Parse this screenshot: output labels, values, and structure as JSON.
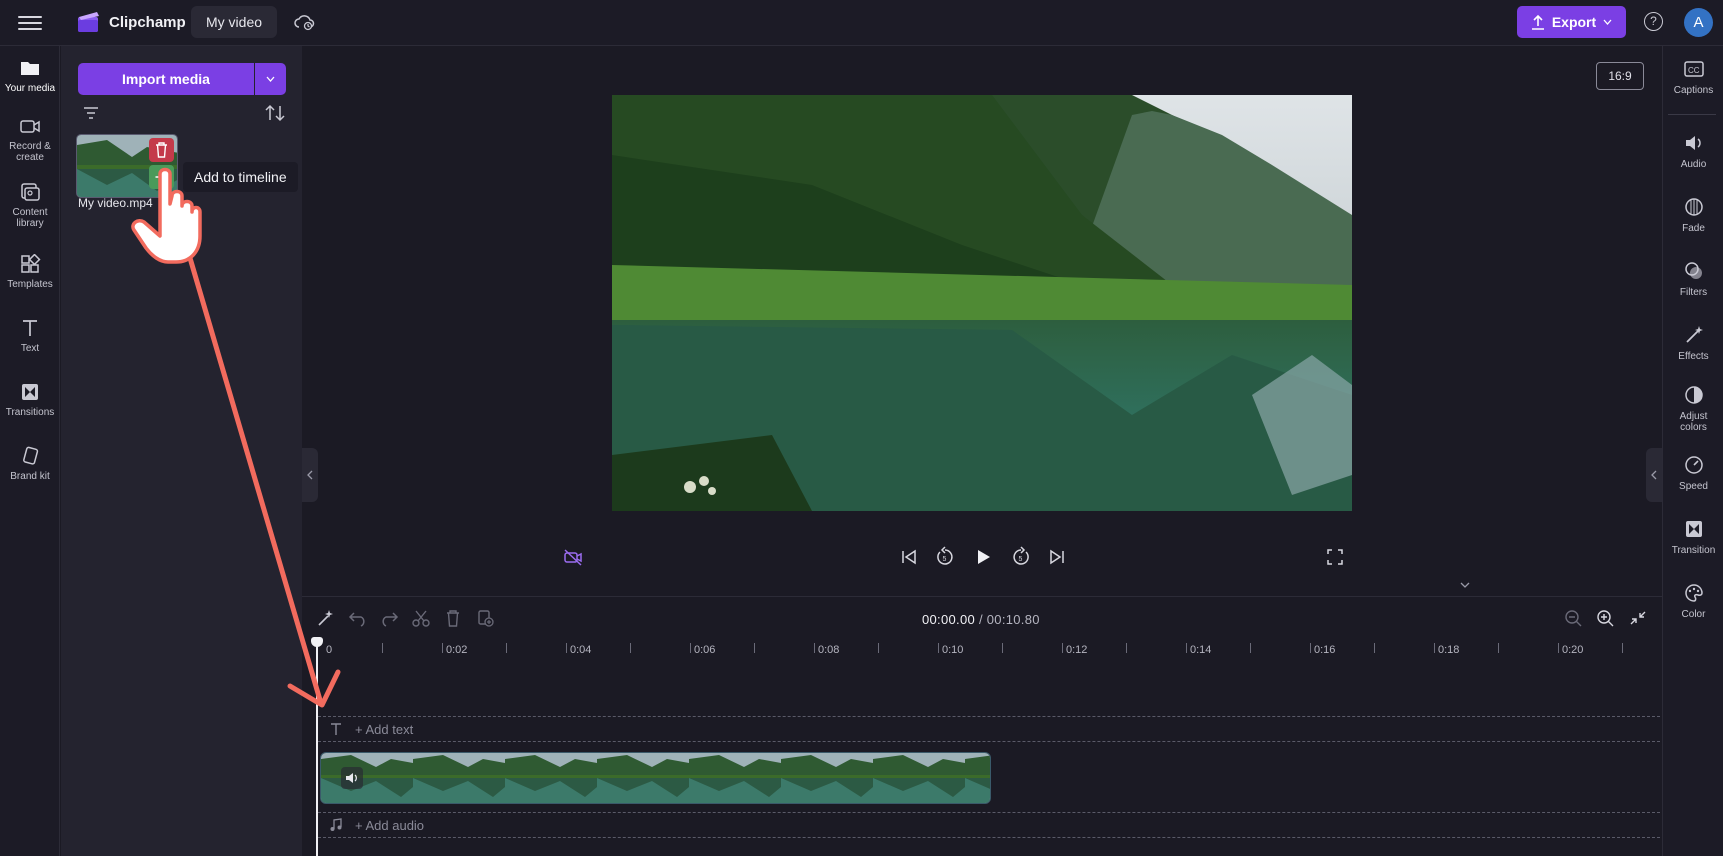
{
  "app": {
    "brand": "Clipchamp",
    "project_title": "My video",
    "export_label": "Export",
    "help_glyph": "?",
    "avatar_initial": "A",
    "accent_color": "#7b3fe4"
  },
  "left_rail": {
    "items": [
      {
        "label": "Your media",
        "icon": "folder-icon"
      },
      {
        "label": "Record & create",
        "icon": "camera-icon"
      },
      {
        "label": "Content library",
        "icon": "library-icon"
      },
      {
        "label": "Templates",
        "icon": "templates-icon"
      },
      {
        "label": "Text",
        "icon": "text-icon"
      },
      {
        "label": "Transitions",
        "icon": "transitions-icon"
      },
      {
        "label": "Brand kit",
        "icon": "brand-kit-icon"
      }
    ]
  },
  "media_panel": {
    "import_label": "Import media",
    "file_name": "My video.mp4",
    "tooltip": "Add to timeline"
  },
  "preview": {
    "aspect_ratio": "16:9"
  },
  "right_rail": {
    "items": [
      {
        "label": "Captions",
        "icon": "captions-icon"
      },
      {
        "label": "Audio",
        "icon": "speaker-icon"
      },
      {
        "label": "Fade",
        "icon": "fade-icon"
      },
      {
        "label": "Filters",
        "icon": "filters-icon"
      },
      {
        "label": "Effects",
        "icon": "magic-wand-icon"
      },
      {
        "label": "Adjust colors",
        "icon": "adjust-colors-icon"
      },
      {
        "label": "Speed",
        "icon": "speedometer-icon"
      },
      {
        "label": "Transition",
        "icon": "transition-icon"
      },
      {
        "label": "Color",
        "icon": "palette-icon"
      }
    ]
  },
  "timeline": {
    "current_time": "00:00.00",
    "duration": "/ 00:10.80",
    "ruler_labels": [
      "0",
      "0:02",
      "0:04",
      "0:06",
      "0:08",
      "0:10",
      "0:12",
      "0:14",
      "0:16",
      "0:18",
      "0:20"
    ],
    "add_text_label": "+ Add text",
    "add_audio_label": "+ Add audio"
  }
}
